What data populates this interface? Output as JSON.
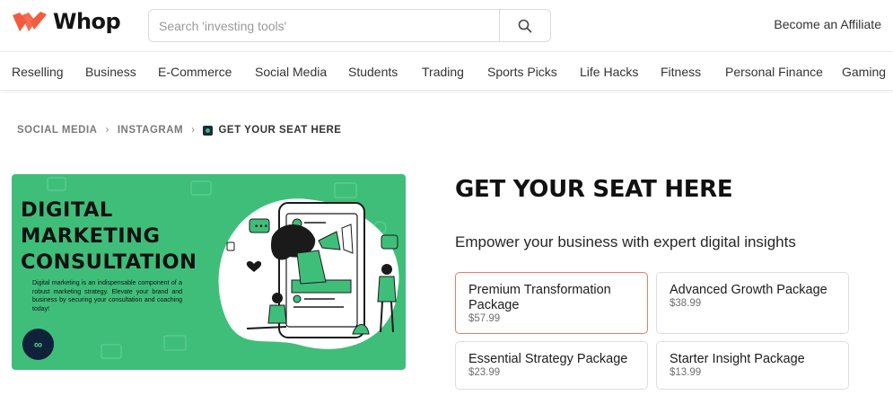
{
  "header": {
    "brand": "Whop",
    "brand_color": "#f35b3f",
    "search_placeholder": "Search 'investing tools'",
    "search_icon": "search-icon",
    "affiliate_label": "Become an Affiliate"
  },
  "categories": [
    "Reselling",
    "Business",
    "E-Commerce",
    "Social Media",
    "Students",
    "Trading",
    "Sports Picks",
    "Life Hacks",
    "Fitness",
    "Personal Finance",
    "Gaming"
  ],
  "breadcrumb": {
    "items": [
      "SOCIAL MEDIA",
      "INSTAGRAM"
    ],
    "current": "GET YOUR SEAT HERE"
  },
  "banner": {
    "title_lines": [
      "DIGITAL",
      "MARKETING",
      "CONSULTATION"
    ],
    "description": "Digital marketing is an indispensable component of a robust marketing strategy. Elevate your brand and business by securing your consultation and coaching today!",
    "background_color": "#3fbe7a"
  },
  "product": {
    "title": "GET YOUR SEAT HERE",
    "tagline": "Empower your business with expert digital insights",
    "selected_border_color": "#ef7a68",
    "packages": [
      {
        "name": "Premium Transformation Package",
        "price": "$57.99",
        "selected": true
      },
      {
        "name": "Advanced Growth Package",
        "price": "$38.99",
        "selected": false
      },
      {
        "name": "Essential Strategy Package",
        "price": "$23.99",
        "selected": false
      },
      {
        "name": "Starter Insight Package",
        "price": "$13.99",
        "selected": false
      }
    ]
  }
}
